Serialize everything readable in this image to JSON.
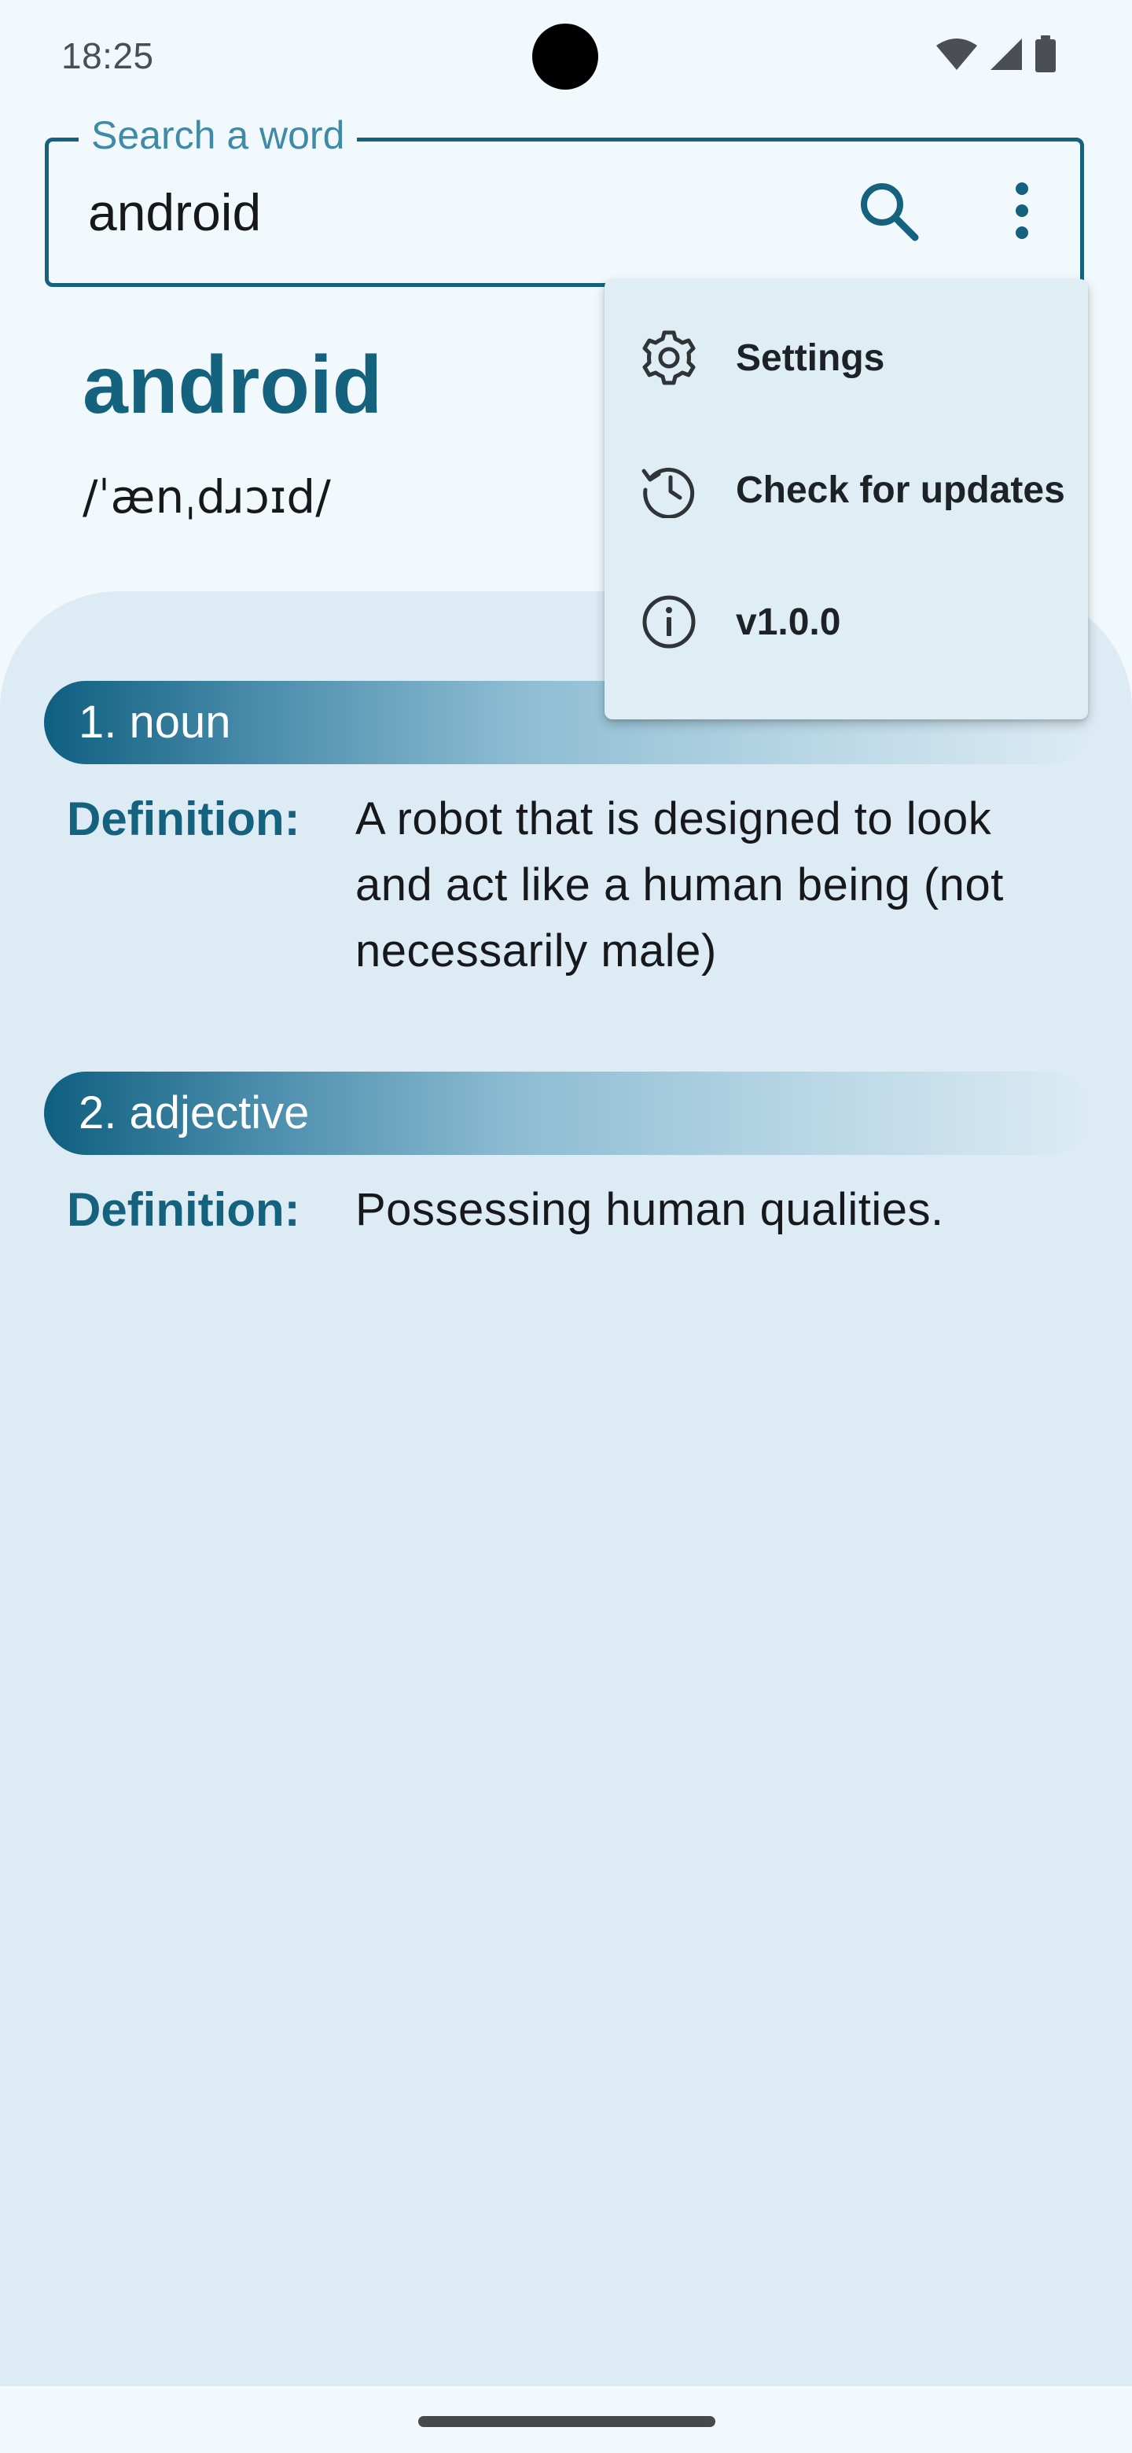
{
  "status_bar": {
    "time": "18:25",
    "icons": [
      "wifi-icon",
      "cellular-signal-icon",
      "battery-icon"
    ]
  },
  "search": {
    "label": "Search a word",
    "value": "android"
  },
  "word": {
    "title": "android",
    "phonetic": "/ˈænˌdɹɔɪd/"
  },
  "meanings": [
    {
      "part_of_speech": "1. noun",
      "definition_label": "Definition:",
      "definition": "A robot that is designed to look and act like a human being (not necessarily male)"
    },
    {
      "part_of_speech": "2. adjective",
      "definition_label": "Definition:",
      "definition": "Possessing human qualities."
    }
  ],
  "menu": {
    "items": [
      {
        "label": "Settings",
        "icon": "gear-icon"
      },
      {
        "label": "Check for updates",
        "icon": "update-icon"
      },
      {
        "label": "v1.0.0",
        "icon": "info-icon"
      }
    ]
  },
  "colors": {
    "accent": "#15627f",
    "background": "#f2f9fd",
    "sheet": "#dcebf4",
    "menu": "#dfeef4"
  }
}
